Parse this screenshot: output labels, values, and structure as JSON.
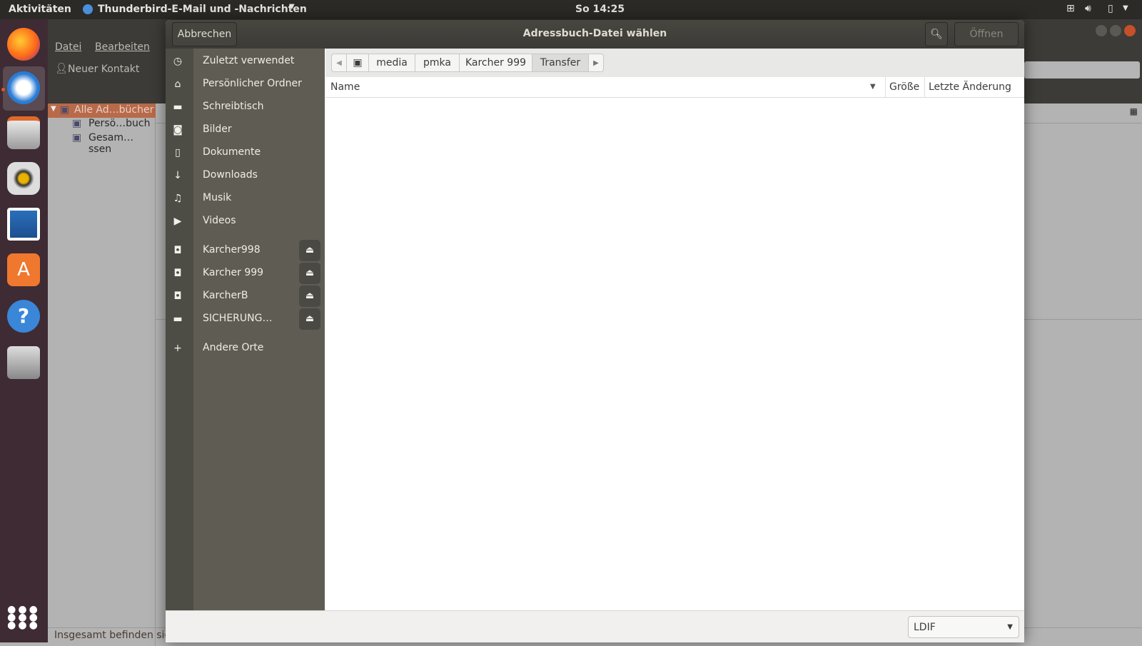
{
  "topbar": {
    "activities": "Aktivitäten",
    "app_name": "Thunderbird-E-Mail und -Nachrichten",
    "clock": "So 14:25"
  },
  "dock": {
    "items": [
      "firefox-icon",
      "thunderbird-icon",
      "files-icon",
      "rhythmbox-icon",
      "writer-icon",
      "software-icon",
      "help-icon",
      "camera-icon",
      "app-grid-icon"
    ]
  },
  "thunderbird": {
    "menu": [
      "Datei",
      "Bearbeiten"
    ],
    "toolbar": {
      "new_contact": "Neuer Kontakt"
    },
    "tree": [
      "Alle Ad…bücher",
      "Persö…buch",
      "Gesam…ssen"
    ],
    "status": "Insgesamt befinden sic"
  },
  "dialog": {
    "title": "Adressbuch-Datei wählen",
    "cancel": "Abbrechen",
    "open": "Öffnen",
    "sidebar": {
      "places": [
        {
          "label": "Zuletzt verwendet",
          "icon": "clock-icon"
        },
        {
          "label": "Persönlicher Ordner",
          "icon": "home-icon"
        },
        {
          "label": "Schreibtisch",
          "icon": "folder-icon"
        },
        {
          "label": "Bilder",
          "icon": "camera-icon"
        },
        {
          "label": "Dokumente",
          "icon": "document-icon"
        },
        {
          "label": "Downloads",
          "icon": "download-icon"
        },
        {
          "label": "Musik",
          "icon": "music-icon"
        },
        {
          "label": "Videos",
          "icon": "video-icon"
        }
      ],
      "drives": [
        {
          "label": "Karcher998"
        },
        {
          "label": "Karcher 999"
        },
        {
          "label": "KarcherB"
        },
        {
          "label": "SICHERUNG…"
        }
      ],
      "other": "Andere Orte"
    },
    "path": [
      "media",
      "pmka",
      "Karcher 999",
      "Transfer"
    ],
    "columns": {
      "name": "Name",
      "size": "Größe",
      "modified": "Letzte Änderung"
    },
    "filter": "LDIF"
  }
}
